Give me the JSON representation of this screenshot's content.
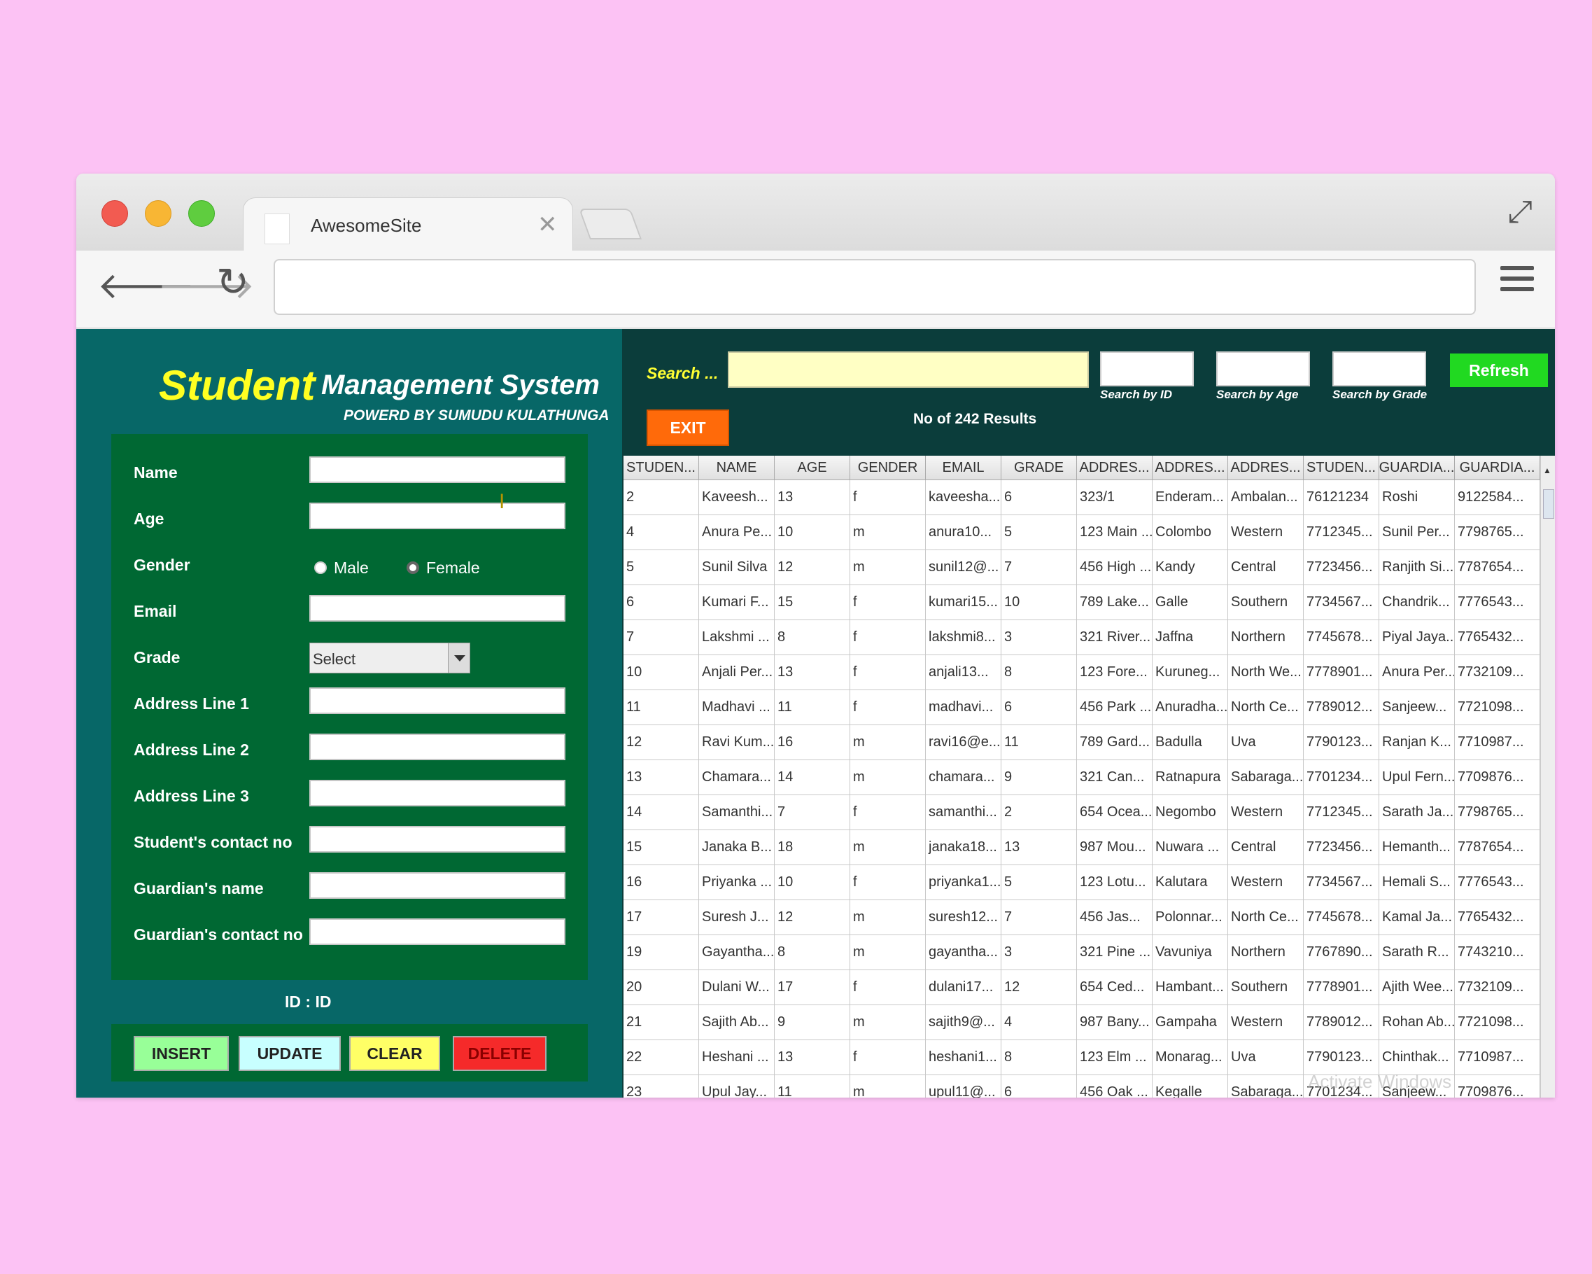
{
  "browser": {
    "tab_title": "AwesomeSite",
    "close_glyph": "✕",
    "url": ""
  },
  "icons": {
    "back": "🡐",
    "forward": "🡒",
    "reload": "↻",
    "expand": "⤢",
    "cursor": "I"
  },
  "app": {
    "title_student": "Student",
    "title_rest": "Management System",
    "powered": "POWERD BY SUMUDU KULATHUNGA",
    "form": {
      "name_label": "Name",
      "age_label": "Age",
      "gender_label": "Gender",
      "male_label": "Male",
      "female_label": "Female",
      "email_label": "Email",
      "grade_label": "Grade",
      "grade_value": "Select",
      "addr1_label": "Address Line 1",
      "addr2_label": "Address Line 2",
      "addr3_label": "Address Line 3",
      "contact_label": "Student's contact no",
      "guardian_label": "Guardian's name",
      "guardian_contact_label": "Guardian's contact no"
    },
    "id_line": "ID :  ID",
    "buttons": {
      "insert": "INSERT",
      "update": "UPDATE",
      "clear": "CLEAR",
      "delete": "DELETE"
    },
    "search": {
      "label": "Search ...",
      "by_id": "Search by ID",
      "by_age": "Search by Age",
      "by_grade": "Search by Grade",
      "refresh": "Refresh",
      "exit": "EXIT",
      "results": "No of 242 Results"
    },
    "watermark": "Activate Windows"
  },
  "table": {
    "headers": [
      "STUDEN...",
      "NAME",
      "AGE",
      "GENDER",
      "EMAIL",
      "GRADE",
      "ADDRES...",
      "ADDRES...",
      "ADDRES...",
      "STUDEN...",
      "GUARDIA...",
      "GUARDIA..."
    ],
    "rows": [
      [
        "2",
        "Kaveesh...",
        "13",
        "f",
        "kaveesha...",
        "6",
        "323/1",
        "Enderam...",
        "Ambalan...",
        "76121234",
        "Roshi",
        "9122584..."
      ],
      [
        "4",
        "Anura Pe...",
        "10",
        "m",
        "anura10...",
        "5",
        "123 Main ...",
        "Colombo",
        "Western",
        "7712345...",
        "Sunil Per...",
        "7798765..."
      ],
      [
        "5",
        "Sunil Silva",
        "12",
        "m",
        "sunil12@...",
        "7",
        "456 High ...",
        "Kandy",
        "Central",
        "7723456...",
        "Ranjith Si...",
        "7787654..."
      ],
      [
        "6",
        "Kumari F...",
        "15",
        "f",
        "kumari15...",
        "10",
        "789 Lake...",
        "Galle",
        "Southern",
        "7734567...",
        "Chandrik...",
        "7776543..."
      ],
      [
        "7",
        "Lakshmi ...",
        "8",
        "f",
        "lakshmi8...",
        "3",
        "321 River...",
        "Jaffna",
        "Northern",
        "7745678...",
        "Piyal Jaya...",
        "7765432..."
      ],
      [
        "10",
        "Anjali Per...",
        "13",
        "f",
        "anjali13...",
        "8",
        "123 Fore...",
        "Kuruneg...",
        "North We...",
        "7778901...",
        "Anura Per...",
        "7732109..."
      ],
      [
        "11",
        "Madhavi ...",
        "11",
        "f",
        "madhavi...",
        "6",
        "456 Park ...",
        "Anuradha...",
        "North Ce...",
        "7789012...",
        "Sanjeew...",
        "7721098..."
      ],
      [
        "12",
        "Ravi Kum...",
        "16",
        "m",
        "ravi16@e...",
        "11",
        "789 Gard...",
        "Badulla",
        "Uva",
        "7790123...",
        "Ranjan K...",
        "7710987..."
      ],
      [
        "13",
        "Chamara...",
        "14",
        "m",
        "chamara...",
        "9",
        "321 Can...",
        "Ratnapura",
        "Sabaraga...",
        "7701234...",
        "Upul Fern...",
        "7709876..."
      ],
      [
        "14",
        "Samanthi...",
        "7",
        "f",
        "samanthi...",
        "2",
        "654 Ocea...",
        "Negombo",
        "Western",
        "7712345...",
        "Sarath Ja...",
        "7798765..."
      ],
      [
        "15",
        "Janaka B...",
        "18",
        "m",
        "janaka18...",
        "13",
        "987 Mou...",
        "Nuwara ...",
        "Central",
        "7723456...",
        "Hemanth...",
        "7787654..."
      ],
      [
        "16",
        "Priyanka ...",
        "10",
        "f",
        "priyanka1...",
        "5",
        "123 Lotu...",
        "Kalutara",
        "Western",
        "7734567...",
        "Hemali S...",
        "7776543..."
      ],
      [
        "17",
        "Suresh J...",
        "12",
        "m",
        "suresh12...",
        "7",
        "456 Jas...",
        "Polonnar...",
        "North Ce...",
        "7745678...",
        "Kamal Ja...",
        "7765432..."
      ],
      [
        "19",
        "Gayantha...",
        "8",
        "m",
        "gayantha...",
        "3",
        "321 Pine ...",
        "Vavuniya",
        "Northern",
        "7767890...",
        "Sarath R...",
        "7743210..."
      ],
      [
        "20",
        "Dulani W...",
        "17",
        "f",
        "dulani17...",
        "12",
        "654 Ced...",
        "Hambant...",
        "Southern",
        "7778901...",
        "Ajith Wee...",
        "7732109..."
      ],
      [
        "21",
        "Sajith Ab...",
        "9",
        "m",
        "sajith9@...",
        "4",
        "987 Bany...",
        "Gampaha",
        "Western",
        "7789012...",
        "Rohan Ab...",
        "7721098..."
      ],
      [
        "22",
        "Heshani ...",
        "13",
        "f",
        "heshani1...",
        "8",
        "123 Elm ...",
        "Monarag...",
        "Uva",
        "7790123...",
        "Chinthak...",
        "7710987..."
      ],
      [
        "23",
        "Upul Jay...",
        "11",
        "m",
        "upul11@...",
        "6",
        "456 Oak ...",
        "Kegalle",
        "Sabaraga...",
        "7701234...",
        "Sanjeew...",
        "7709876..."
      ]
    ]
  }
}
